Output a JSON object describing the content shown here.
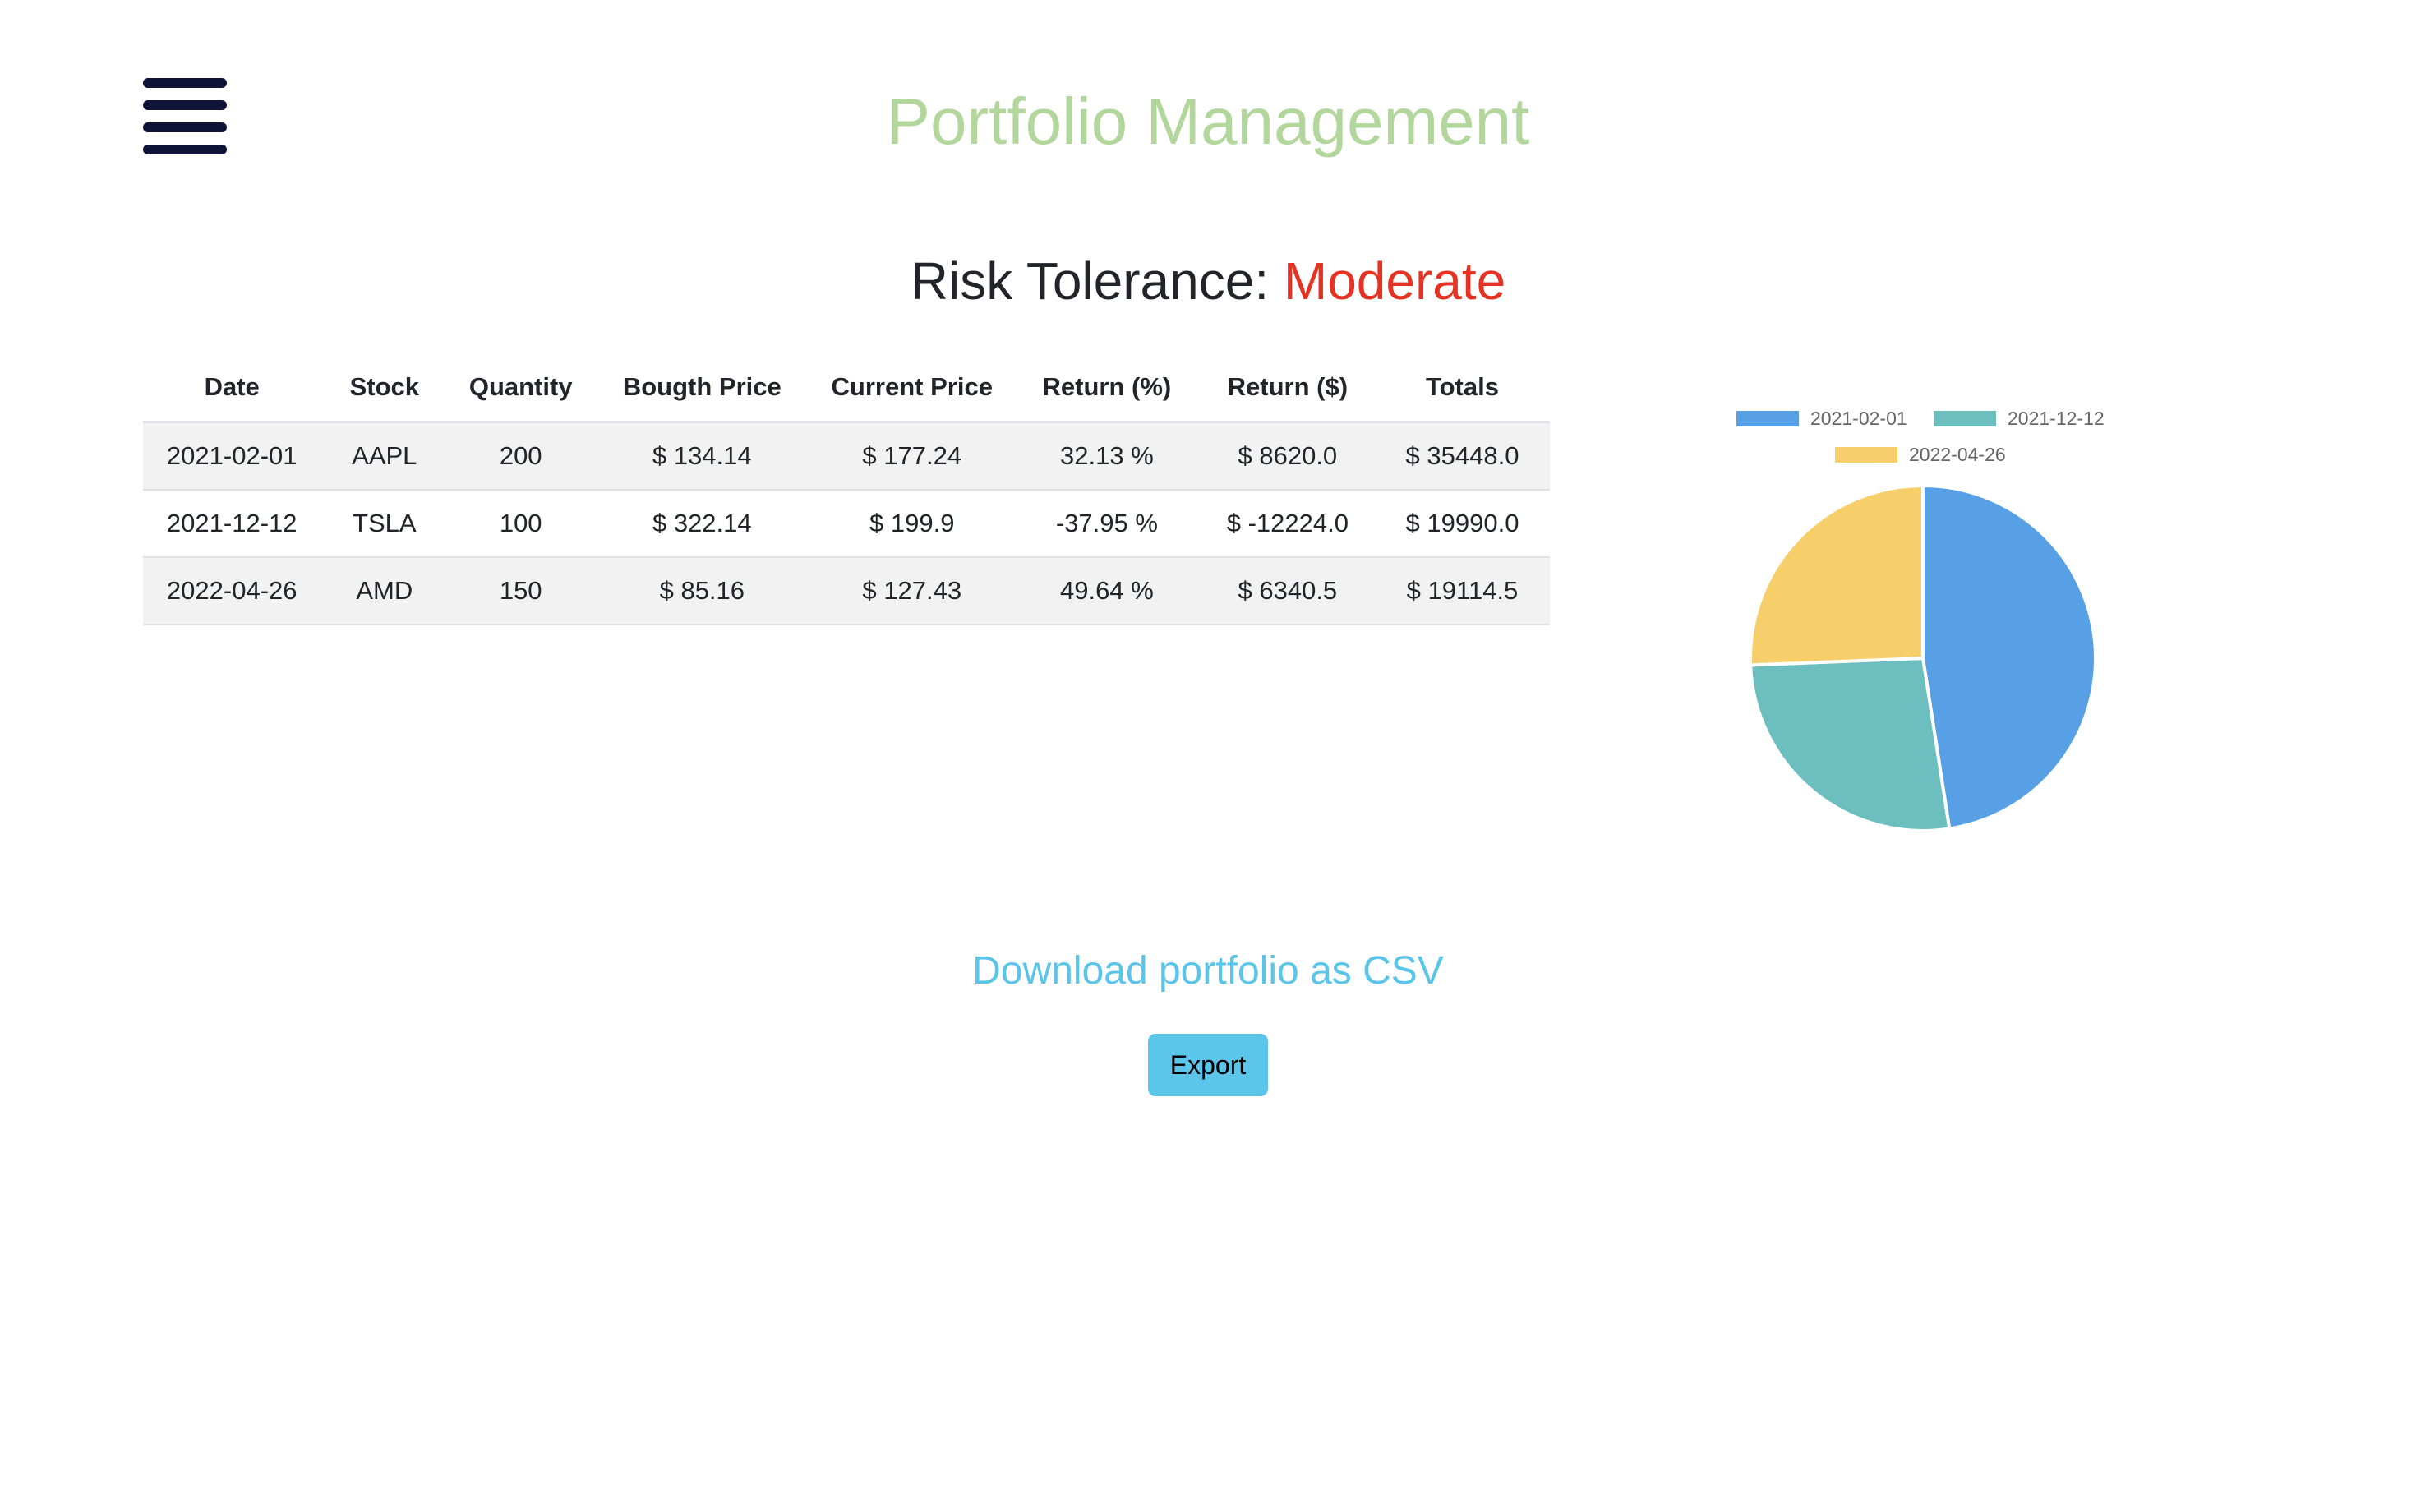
{
  "header": {
    "title": "Portfolio Management",
    "menu_icon": "hamburger-menu-icon",
    "title_color": "#b2d69b"
  },
  "risk": {
    "label": "Risk Tolerance:",
    "value": "Moderate",
    "value_color": "#e53222"
  },
  "table": {
    "columns": [
      "Date",
      "Stock",
      "Quantity",
      "Bougth Price",
      "Current Price",
      "Return (%)",
      "Return ($)",
      "Totals"
    ],
    "rows": [
      [
        "2021-02-01",
        "AAPL",
        "200",
        "$ 134.14",
        "$ 177.24",
        "32.13 %",
        "$ 8620.0",
        "$ 35448.0"
      ],
      [
        "2021-12-12",
        "TSLA",
        "100",
        "$ 322.14",
        "$ 199.9",
        "-37.95 %",
        "$ -12224.0",
        "$ 19990.0"
      ],
      [
        "2022-04-26",
        "AMD",
        "150",
        "$ 85.16",
        "$ 127.43",
        "49.64 %",
        "$ 6340.5",
        "$ 19114.5"
      ]
    ]
  },
  "chart_data": {
    "type": "pie",
    "labels": [
      "2021-02-01",
      "2021-12-12",
      "2022-04-26"
    ],
    "values": [
      35448.0,
      19990.0,
      19114.5
    ],
    "colors": [
      "#57a0e5",
      "#6dbebf",
      "#f6cf6b"
    ],
    "legend_position": "top"
  },
  "download": {
    "heading": "Download portfolio as CSV",
    "button_label": "Export",
    "heading_color": "#5bc4e9",
    "button_color": "#5bc5ea"
  }
}
